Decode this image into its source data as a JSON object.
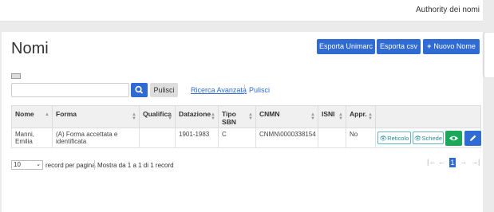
{
  "header": {
    "brand": "Authority dei nomi"
  },
  "page": {
    "title": "Nomi"
  },
  "actions": {
    "export_unimarc": "Esporta Unimarc",
    "export_csv": "Esporta csv",
    "new_name": "Nuovo Nome"
  },
  "search": {
    "value": "",
    "placeholder": "",
    "clear_label": "Pulisci",
    "advanced_link": "Ricerca Avanzata",
    "clear_link": "Pulisci"
  },
  "table": {
    "columns": [
      "Nome",
      "Forma",
      "Qualifica",
      "Datazione",
      "Tipo SBN",
      "CNMN",
      "ISNI",
      "Appr.",
      ""
    ],
    "rows": [
      {
        "nome": "Manni, Emilia",
        "forma": "(A) Forma accettata e identificata",
        "qualifica": "",
        "datazione": "1901-1983",
        "tipo_sbn": "C",
        "cnmn": "CNMN\\0000338154",
        "isni": "",
        "appr": "No",
        "btn_reticolo": "Reticolo",
        "btn_schede": "Schede"
      }
    ]
  },
  "footer": {
    "page_size": "10",
    "per_page_label": "record per pagina",
    "info": "Mostra da 1 a 1 di 1 record",
    "pager": {
      "first": "|←",
      "prev": "←",
      "current": "1",
      "next": "→",
      "last": "→|"
    }
  },
  "colors": {
    "primary": "#2f6bd2",
    "success": "#1aa85b",
    "info": "#5fb7bf"
  }
}
